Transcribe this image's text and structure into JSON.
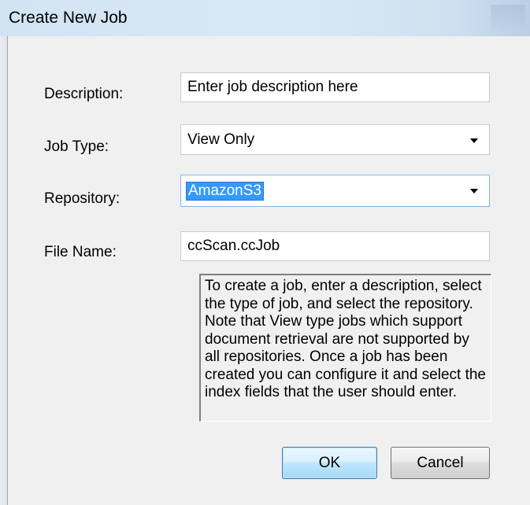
{
  "window": {
    "title": "Create New Job"
  },
  "form": {
    "description": {
      "label": "Description:",
      "value": "Enter job description here"
    },
    "job_type": {
      "label": "Job Type:",
      "value": "View Only"
    },
    "repository": {
      "label": "Repository:",
      "value": "AmazonS3"
    },
    "file_name": {
      "label": "File Name:",
      "value": "ccScan.ccJob"
    }
  },
  "help_text": "To create a job, enter a description, select the type of job, and select the repository. Note that View type jobs which support document retrieval are not supported by all repositories. Once a job has been created you can configure it and select the index fields that the user should enter.",
  "buttons": {
    "ok_label": "OK",
    "cancel_label": "Cancel"
  }
}
